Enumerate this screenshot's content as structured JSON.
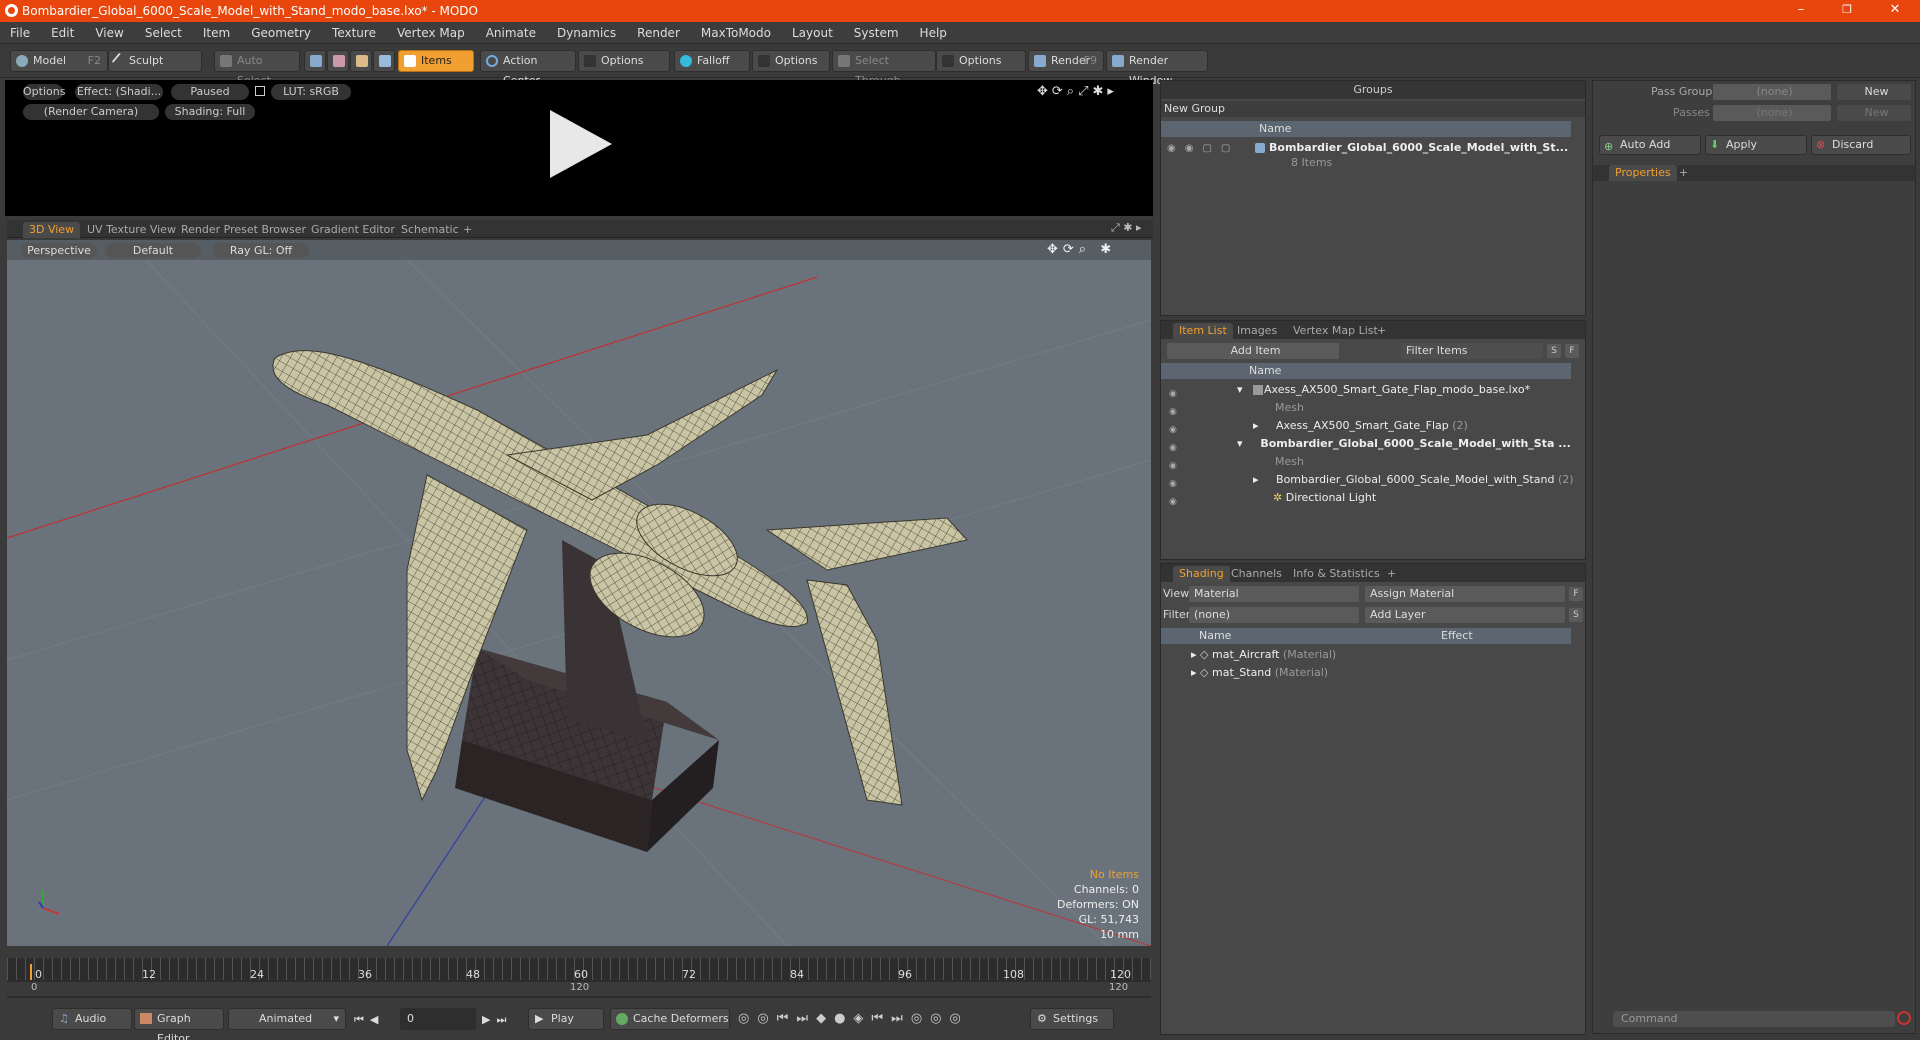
{
  "window": {
    "title": "Bombardier_Global_6000_Scale_Model_with_Stand_modo_base.lxo* - MODO",
    "minimize": "–",
    "restore": "❐",
    "close": "✕"
  },
  "menu": [
    "File",
    "Edit",
    "View",
    "Select",
    "Item",
    "Geometry",
    "Texture",
    "Vertex Map",
    "Animate",
    "Dynamics",
    "Render",
    "MaxToModo",
    "Layout",
    "System",
    "Help"
  ],
  "toolbar": {
    "model": "Model",
    "model_key": "F2",
    "sculpt": "Sculpt",
    "auto_select": "Auto Select",
    "items": "Items",
    "action_center": "Action Center",
    "options1": "Options",
    "falloff": "Falloff",
    "options2": "Options",
    "select_through": "Select Through",
    "options3": "Options",
    "render": "Render",
    "render_key": "F9",
    "render_window": "Render Window"
  },
  "render_preview": {
    "options": "Options",
    "effect": "Effect: (Shadi...",
    "paused": "Paused",
    "lut": "LUT: sRGB",
    "camera": "(Render Camera)",
    "shading": "Shading: Full"
  },
  "viewport_tabs": [
    "3D View",
    "UV Texture View",
    "Render Preset Browser",
    "Gradient Editor",
    "Schematic",
    "+"
  ],
  "viewport": {
    "perspective": "Perspective",
    "default": "Default",
    "raygl": "Ray GL: Off",
    "stats": {
      "no_items": "No Items",
      "channels": "Channels: 0",
      "deformers": "Deformers: ON",
      "gl": "GL: 51,743",
      "scale": "10 mm"
    }
  },
  "timeline": {
    "ticks": [
      "0",
      "12",
      "24",
      "36",
      "48",
      "60",
      "72",
      "84",
      "96",
      "108",
      "120"
    ],
    "range_start": "0",
    "range_mid": "120",
    "range_end": "120"
  },
  "bottom": {
    "audio": "Audio",
    "graph_editor": "Graph Editor",
    "animated": "Animated",
    "frame": "0",
    "play": "Play",
    "cache_deformers": "Cache Deformers",
    "settings": "Settings"
  },
  "groups": {
    "header": "Groups",
    "new_group": "New Group",
    "col_name": "Name",
    "item_name": "Bombardier_Global_6000_Scale_Model_with_St...",
    "item_count": "8 Items"
  },
  "pass_groups": {
    "pass_groups_label": "Pass Groups",
    "pass_groups_value": "(none)",
    "passes_label": "Passes",
    "passes_value": "(none)",
    "new1": "New",
    "new2": "New",
    "auto_add": "Auto Add",
    "apply": "Apply",
    "discard": "Discard",
    "properties": "Properties",
    "plus": "+"
  },
  "item_list": {
    "tabs": [
      "Item List",
      "Images",
      "Vertex Map List",
      "+"
    ],
    "add_item": "Add Item",
    "filter_items": "Filter Items",
    "s": "S",
    "f": "F",
    "col_name": "Name",
    "rows": [
      {
        "label": "Axess_AX500_Smart_Gate_Flap_modo_base.lxo*",
        "extra": "",
        "bold": false,
        "gray": false
      },
      {
        "label": "Mesh",
        "extra": "",
        "bold": false,
        "gray": true
      },
      {
        "label": "Axess_AX500_Smart_Gate_Flap",
        "extra": "(2)",
        "bold": false,
        "gray": false
      },
      {
        "label": "Bombardier_Global_6000_Scale_Model_with_Sta ...",
        "extra": "",
        "bold": true,
        "gray": false
      },
      {
        "label": "Mesh",
        "extra": "",
        "bold": false,
        "gray": true
      },
      {
        "label": "Bombardier_Global_6000_Scale_Model_with_Stand",
        "extra": "(2)",
        "bold": false,
        "gray": false
      },
      {
        "label": "Directional Light",
        "extra": "",
        "bold": false,
        "gray": false
      }
    ]
  },
  "shading": {
    "tabs": [
      "Shading",
      "Channels",
      "Info & Statistics",
      "+"
    ],
    "view_label": "View",
    "view_value": "Material",
    "assign_material": "Assign Material",
    "filter_label": "Filter",
    "filter_value": "(none)",
    "add_layer": "Add Layer",
    "f": "F",
    "s": "S",
    "col_name": "Name",
    "col_effect": "Effect",
    "rows": [
      {
        "label": "mat_Aircraft",
        "type": "(Material)"
      },
      {
        "label": "mat_Stand",
        "type": "(Material)"
      }
    ]
  },
  "command": {
    "placeholder": "Command"
  }
}
